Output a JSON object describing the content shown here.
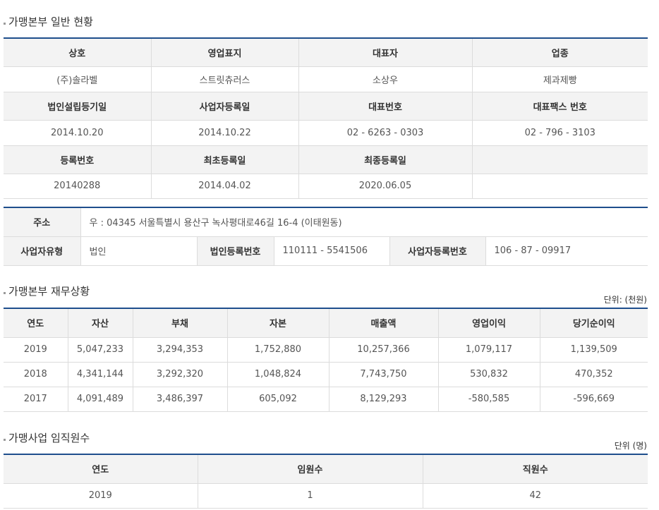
{
  "general": {
    "title": "가맹본부 일반 현황",
    "headers1": [
      "상호",
      "영업표지",
      "대표자",
      "업종"
    ],
    "values1": [
      "(주)솔라벨",
      "스트릿츄러스",
      "소상우",
      "제과제빵"
    ],
    "headers2": [
      "법인설립등기일",
      "사업자등록일",
      "대표번호",
      "대표팩스 번호"
    ],
    "values2": [
      "2014.10.20",
      "2014.10.22",
      "02 - 6263 - 0303",
      "02 - 796 - 3103"
    ],
    "headers3": [
      "등록번호",
      "최초등록일",
      "최종등록일",
      ""
    ],
    "values3": [
      "20140288",
      "2014.04.02",
      "2020.06.05",
      ""
    ]
  },
  "address": {
    "label": "주소",
    "value": "우 : 04345 서울특별시 용산구 녹사평대로46길 16-4 (이태원동)",
    "biz_type_label": "사업자유형",
    "biz_type_value": "법인",
    "corp_no_label": "법인등록번호",
    "corp_no_value": "110111 - 5541506",
    "biz_no_label": "사업자등록번호",
    "biz_no_value": "106 - 87 - 09917"
  },
  "finance": {
    "title": "가맹본부 재무상황",
    "unit": "단위: (천원)",
    "headers": [
      "연도",
      "자산",
      "부채",
      "자본",
      "매출액",
      "영업이익",
      "당기순이익"
    ],
    "rows": [
      [
        "2019",
        "5,047,233",
        "3,294,353",
        "1,752,880",
        "10,257,366",
        "1,079,117",
        "1,139,509"
      ],
      [
        "2018",
        "4,341,144",
        "3,292,320",
        "1,048,824",
        "7,743,750",
        "530,832",
        "470,352"
      ],
      [
        "2017",
        "4,091,489",
        "3,486,397",
        "605,092",
        "8,129,293",
        "-580,585",
        "-596,669"
      ]
    ]
  },
  "staff": {
    "title": "가맹사업 임직원수",
    "unit": "단위 (명)",
    "headers": [
      "연도",
      "임원수",
      "직원수"
    ],
    "rows": [
      [
        "2019",
        "1",
        "42"
      ]
    ]
  }
}
